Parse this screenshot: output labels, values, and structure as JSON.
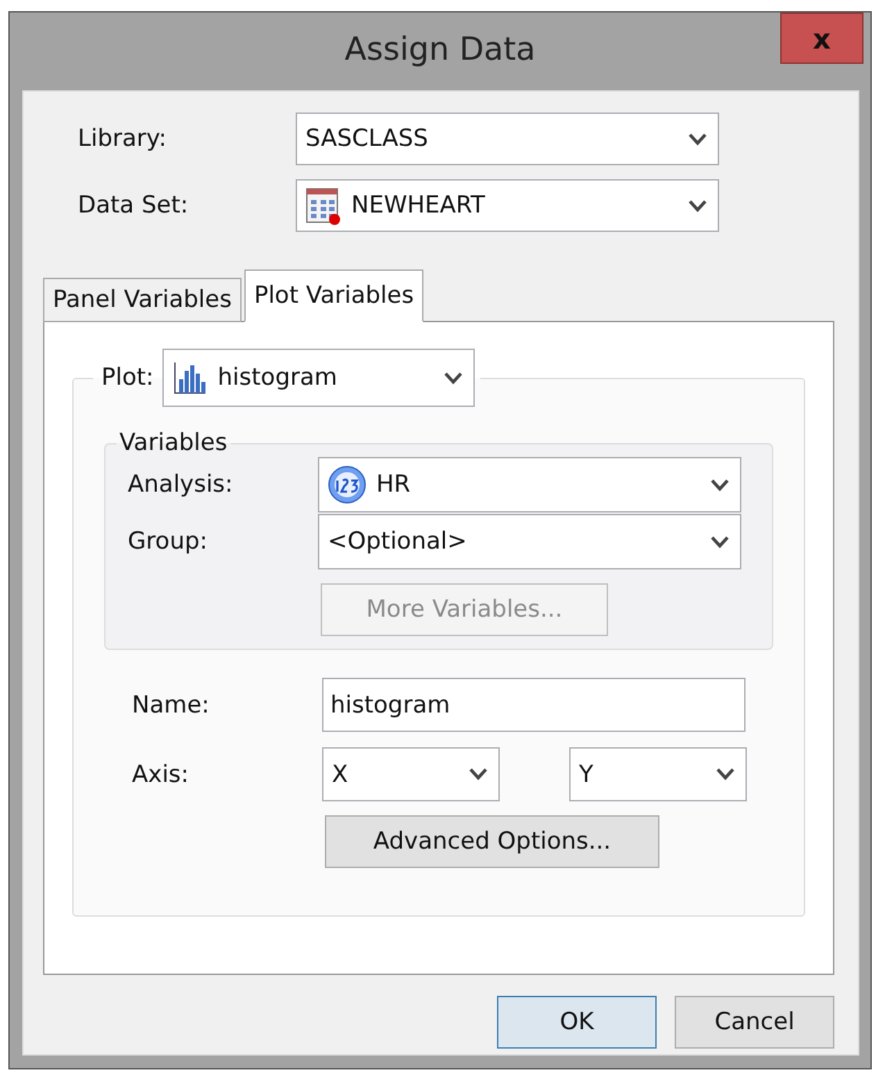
{
  "window": {
    "title": "Assign Data",
    "close": "x"
  },
  "top_fields": [
    {
      "label": "Library:",
      "value": "SASCLASS"
    },
    {
      "label": "Data Set:",
      "value": "NEWHEART"
    }
  ],
  "tabs": [
    {
      "label": "Panel Variables",
      "selected": false
    },
    {
      "label": "Plot Variables",
      "selected": true
    }
  ],
  "plot": {
    "label": "Plot:",
    "value": "histogram"
  },
  "variables": {
    "title": "Variables",
    "fields": [
      {
        "label": "Analysis:",
        "value": "HR"
      },
      {
        "label": "Group:",
        "value": "<Optional>"
      }
    ],
    "more_button": {
      "label": "More Variables...",
      "disabled": true
    }
  },
  "name": {
    "label": "Name:",
    "value": "histogram"
  },
  "axis": {
    "label": "Axis:",
    "x": "X",
    "y": "Y"
  },
  "advanced_button": {
    "label": "Advanced Options...",
    "disabled": false
  },
  "buttons": [
    {
      "label": "OK",
      "default": true
    },
    {
      "label": "Cancel",
      "default": false
    }
  ]
}
